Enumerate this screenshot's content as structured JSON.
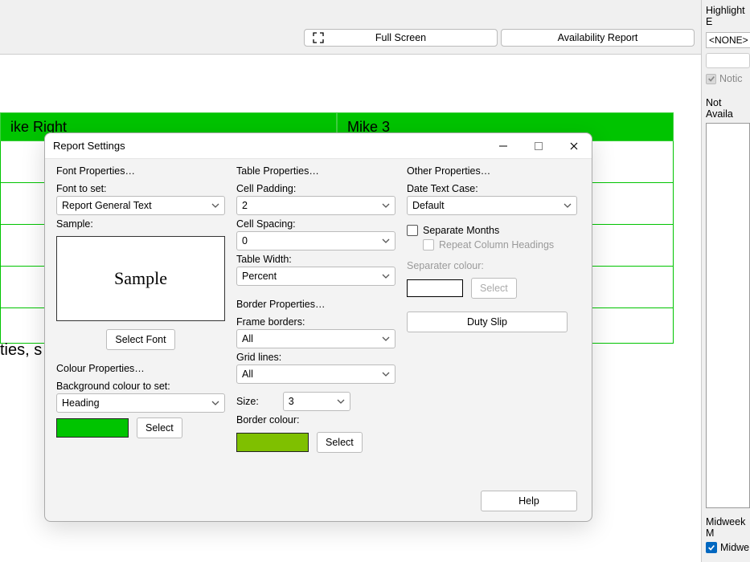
{
  "topbar": {
    "full_screen": "Full Screen",
    "availability_report": "Availability Report"
  },
  "table_headers": [
    "ike Right",
    "Mike 3"
  ],
  "ties_text": "ties, s",
  "right_panel": {
    "highlight_label": "Highlight E",
    "none": "<NONE>",
    "notic": "Notic",
    "not_available": "Not Availa",
    "midweek_label": "Midweek M",
    "midweek_item": "Midwe"
  },
  "dialog": {
    "title": "Report Settings",
    "font_group": "Font Properties…",
    "font_to_set": "Font to set:",
    "font_value": "Report General Text",
    "sample_label": "Sample:",
    "sample_text": "Sample",
    "select_font": "Select Font",
    "colour_group": "Colour Properties…",
    "bg_colour_label": "Background colour to set:",
    "bg_colour_value": "Heading",
    "select": "Select",
    "table_group": "Table Properties…",
    "cell_padding_label": "Cell Padding:",
    "cell_padding_value": "2",
    "cell_spacing_label": "Cell Spacing:",
    "cell_spacing_value": "0",
    "table_width_label": "Table Width:",
    "table_width_value": "Percent",
    "border_group": "Border Properties…",
    "frame_borders_label": "Frame borders:",
    "frame_borders_value": "All",
    "grid_lines_label": "Grid lines:",
    "grid_lines_value": "All",
    "size_label": "Size:",
    "size_value": "3",
    "border_colour_label": "Border colour:",
    "other_group": "Other Properties…",
    "date_case_label": "Date Text Case:",
    "date_case_value": "Default",
    "sep_months": "Separate Months",
    "repeat_headings": "Repeat Column Headings",
    "sep_colour_label": "Separater colour:",
    "duty_slip": "Duty Slip",
    "help": "Help"
  },
  "colors": {
    "heading_bg": "#00c400",
    "border_colour": "#7fc000"
  }
}
